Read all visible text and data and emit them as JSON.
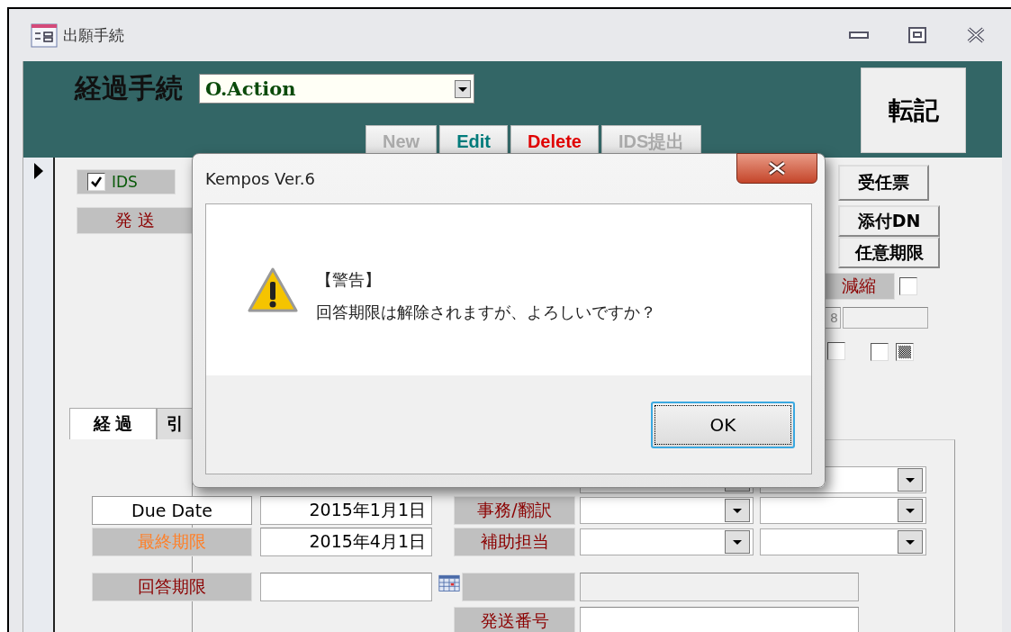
{
  "window": {
    "title": "出願手続"
  },
  "header": {
    "title": "経過手続",
    "action_select": {
      "value": "O.Action"
    },
    "buttons": [
      {
        "label": "New",
        "disabled": true
      },
      {
        "label": "Edit",
        "disabled": false,
        "color": "#007b7b"
      },
      {
        "label": "Delete",
        "disabled": false,
        "color": "#e00000"
      },
      {
        "label": "IDS提出",
        "disabled": true
      }
    ],
    "transfer_button": "転記"
  },
  "form": {
    "ids_checkbox": {
      "label": "IDS",
      "checked": true
    },
    "sent_date_label": "発 送",
    "side_buttons": [
      "受任票",
      "添付DN",
      "任意期限"
    ],
    "reduction": {
      "label": "減縮",
      "checked": false
    },
    "number_field": "8",
    "flags": [
      {
        "kind": "checkbox",
        "checked": false
      },
      {
        "kind": "checkbox",
        "checked": false
      },
      {
        "kind": "swatch"
      }
    ],
    "tabs": [
      {
        "label": "経 過",
        "selected": true
      },
      {
        "label": "引",
        "selected": false
      }
    ],
    "date_rows": [
      {
        "label": "Due Date",
        "kind": "plain",
        "color": "#000000",
        "value": "2015年1月1日",
        "staff_label": "事務/翻訳"
      },
      {
        "label": "最終期限",
        "kind": "shaded",
        "color": "#ff7f27",
        "value": "2015年4月1日",
        "staff_label": "補助担当"
      }
    ],
    "answer_row": {
      "label": "回答期限"
    },
    "send_number_label": "発送番号"
  },
  "dialog": {
    "title": "Kempos Ver.6",
    "heading": "【警告】",
    "message": "回答期限は解除されますが、よろしいですか？",
    "button": "OK"
  }
}
